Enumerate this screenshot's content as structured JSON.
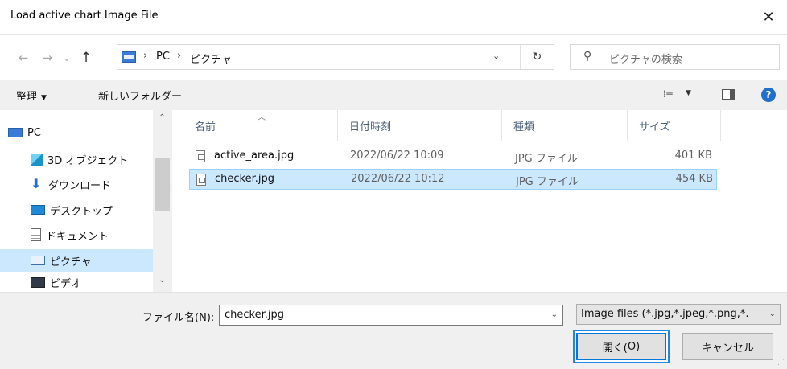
{
  "window": {
    "title": "Load active chart Image File",
    "close_glyph": "✕"
  },
  "nav": {
    "back_glyph": "←",
    "forward_glyph": "→",
    "recent_glyph": "⌄",
    "up_glyph": "↑"
  },
  "address": {
    "crumbs": [
      "PC",
      "ピクチャ"
    ],
    "sep_glyph": "›",
    "refresh_glyph": "↻"
  },
  "search": {
    "placeholder": "ピクチャの検索"
  },
  "toolbar": {
    "organize_label": "整理",
    "new_folder_label": "新しいフォルダー"
  },
  "sidebar": {
    "items": [
      {
        "label": "PC",
        "icon": "pc-icon"
      },
      {
        "label": "3D オブジェクト",
        "icon": "3d-objects-icon"
      },
      {
        "label": "ダウンロード",
        "icon": "download-icon"
      },
      {
        "label": "デスクトップ",
        "icon": "desktop-icon"
      },
      {
        "label": "ドキュメント",
        "icon": "documents-icon"
      },
      {
        "label": "ピクチャ",
        "icon": "pictures-icon",
        "selected": true
      },
      {
        "label": "ビデオ",
        "icon": "videos-icon"
      }
    ]
  },
  "filelist": {
    "columns": [
      "名前",
      "日付時刻",
      "種類",
      "サイズ"
    ],
    "rows": [
      {
        "name": "active_area.jpg",
        "date": "2022/06/22 10:09",
        "type": "JPG ファイル",
        "size": "401 KB",
        "selected": false
      },
      {
        "name": "checker.jpg",
        "date": "2022/06/22 10:12",
        "type": "JPG ファイル",
        "size": "454 KB",
        "selected": true
      }
    ]
  },
  "footer": {
    "filename_label_pre": "ファイル名(",
    "filename_label_key": "N",
    "filename_label_post": "):",
    "filename_value": "checker.jpg",
    "filter_value": "Image files (*.jpg,*.jpeg,*.png,*.",
    "open_pre": "開く(",
    "open_key": "O",
    "open_post": ")",
    "cancel_label": "キャンセル"
  },
  "colors": {
    "selection": "#cce8ff",
    "accent": "#0078d7"
  }
}
